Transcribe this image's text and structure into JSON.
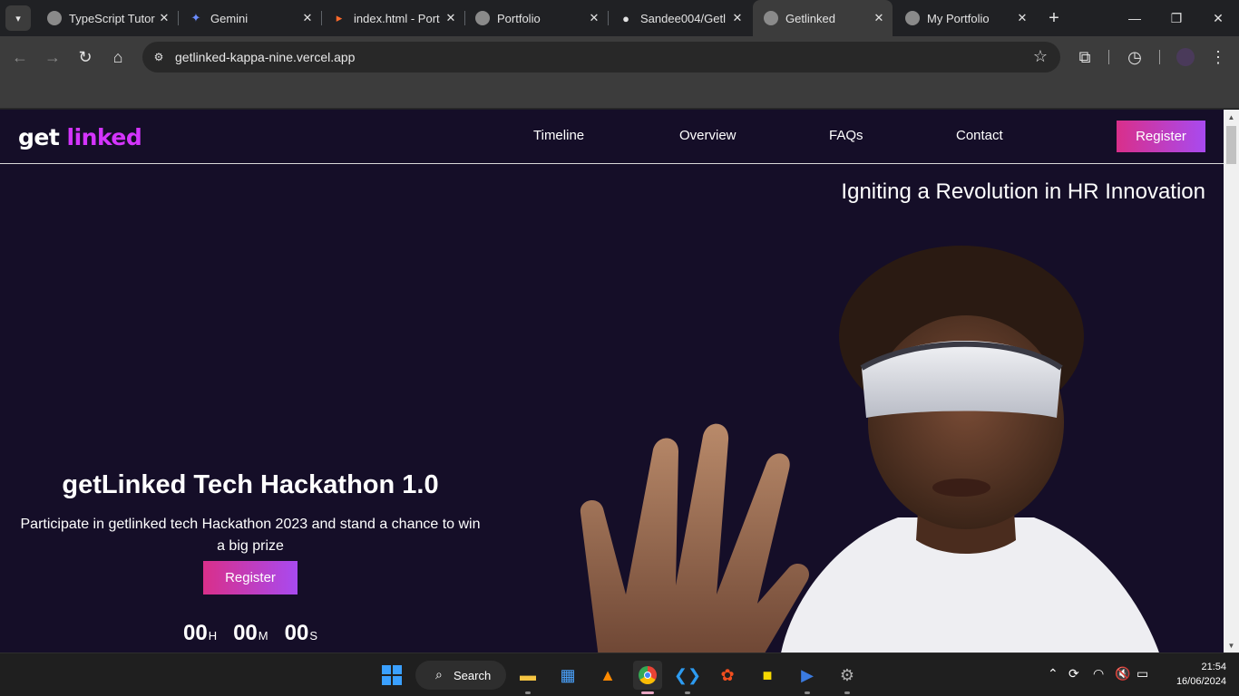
{
  "browser": {
    "tabs": [
      {
        "title": "TypeScript Tutor",
        "icon": "globe-icon",
        "active": false
      },
      {
        "title": "Gemini",
        "icon": "gemini-sparkle-icon",
        "active": false
      },
      {
        "title": "index.html - Port",
        "icon": "codepen-icon",
        "active": false
      },
      {
        "title": "Portfolio",
        "icon": "globe-icon",
        "active": false
      },
      {
        "title": "Sandee004/Getl",
        "icon": "github-icon",
        "active": false
      },
      {
        "title": "Getlinked",
        "icon": "globe-icon",
        "active": true
      },
      {
        "title": "My Portfolio",
        "icon": "globe-icon",
        "active": false
      }
    ],
    "close_glyph": "✕",
    "new_tab_glyph": "+",
    "address": "getlinked-kappa-nine.vercel.app"
  },
  "site": {
    "logo_prefix": "get",
    "logo_accent": "linked",
    "nav": [
      "Timeline",
      "Overview",
      "FAQs",
      "Contact"
    ],
    "nav_button": "Register",
    "tagline": "Igniting a Revolution in HR Innovation",
    "hero": {
      "title": "getLinked Tech Hackathon 1.0",
      "subtitle": "Participate in getlinked tech Hackathon 2023 and stand a chance to win a big prize",
      "button": "Register"
    },
    "countdown": [
      {
        "value": "00",
        "unit": "H"
      },
      {
        "value": "00",
        "unit": "M"
      },
      {
        "value": "00",
        "unit": "S"
      }
    ],
    "colors": {
      "background": "#150e28",
      "accent": "#d434fe",
      "button_start": "#d92f8a",
      "button_end": "#a84af0"
    }
  },
  "taskbar": {
    "search_label": "Search",
    "time": "21:54",
    "date": "16/06/2024"
  }
}
